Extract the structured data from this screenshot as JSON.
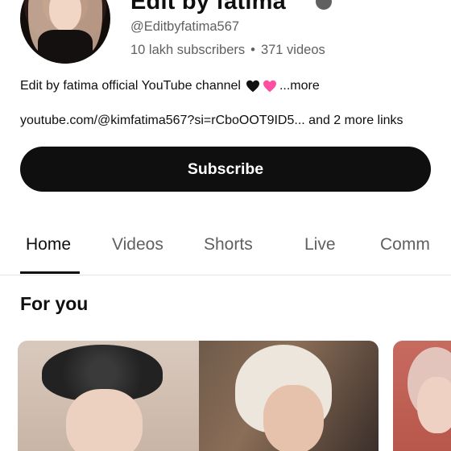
{
  "channel": {
    "name": "Edit by fatima",
    "handle": "@Editbyfatima567",
    "subscribers": "10 lakh subscribers",
    "separator": "•",
    "videos": "371 videos",
    "description": "Edit by fatima official YouTube channel",
    "description_more": "...more",
    "links": "youtube.com/@kimfatima567?si=rCboOOT9ID5... and 2 more links"
  },
  "subscribe": {
    "label": "Subscribe"
  },
  "tabs": [
    {
      "label": "Home",
      "active": true
    },
    {
      "label": "Videos",
      "active": false
    },
    {
      "label": "Shorts",
      "active": false
    },
    {
      "label": "Live",
      "active": false
    },
    {
      "label": "Comm",
      "active": false
    }
  ],
  "section": {
    "title": "For you"
  },
  "icons": {
    "verified": "verified-badge-icon",
    "heart_black": "black-heart-icon",
    "heart_pink": "pink-heart-icon"
  },
  "colors": {
    "text_primary": "#0f0f0f",
    "text_secondary": "#606060",
    "subscribe_bg": "#0f0f0f",
    "pink_heart": "#ff4fa0"
  }
}
